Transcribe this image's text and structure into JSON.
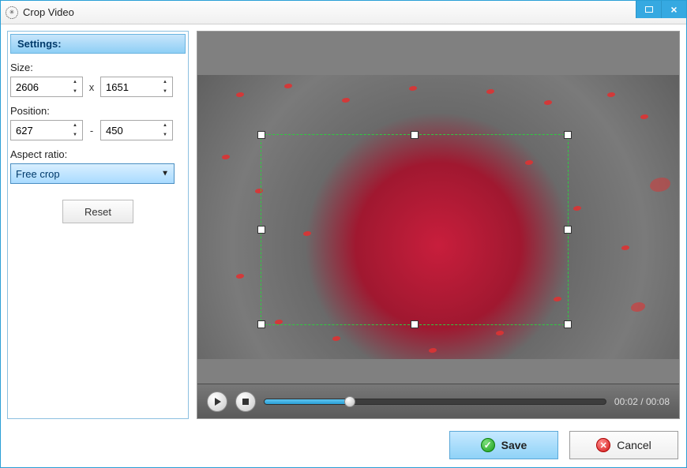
{
  "window": {
    "title": "Crop Video"
  },
  "settings": {
    "header": "Settings:",
    "size_label": "Size:",
    "size_w": "2606",
    "size_sep": "x",
    "size_h": "1651",
    "position_label": "Position:",
    "pos_x": "627",
    "pos_sep": "-",
    "pos_y": "450",
    "aspect_label": "Aspect ratio:",
    "aspect_value": "Free crop",
    "reset": "Reset"
  },
  "player": {
    "time_current": "00:02",
    "time_sep": " / ",
    "time_total": "00:08"
  },
  "buttons": {
    "save": "Save",
    "cancel": "Cancel"
  }
}
